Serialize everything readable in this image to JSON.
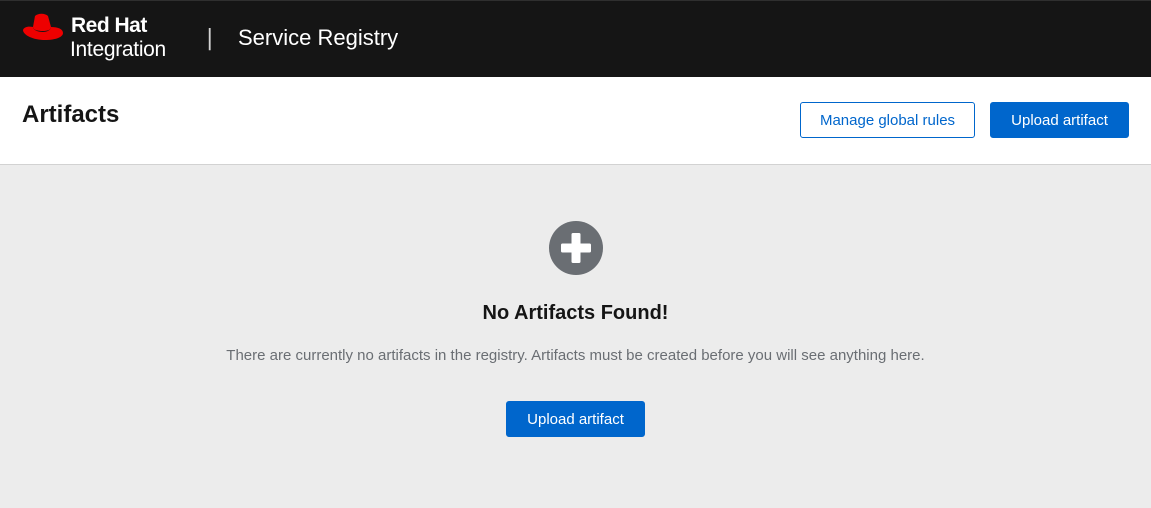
{
  "masthead": {
    "brand_line1": "Red Hat",
    "brand_line2": "Integration",
    "divider": "|",
    "product_title": "Service Registry",
    "logo_icon": "red-hat-fedora-logo",
    "logo_color": "#ee0000"
  },
  "page_header": {
    "title": "Artifacts",
    "manage_rules_label": "Manage global rules",
    "upload_label": "Upload artifact"
  },
  "empty_state": {
    "icon": "plus-circle-icon",
    "title": "No Artifacts Found!",
    "body": "There are currently no artifacts in the registry. Artifacts must be created before you will see anything here.",
    "upload_label": "Upload artifact"
  },
  "colors": {
    "masthead_bg": "#151515",
    "accent": "#0066cc",
    "content_bg": "#ececec",
    "icon_gray": "#6a6e73"
  }
}
